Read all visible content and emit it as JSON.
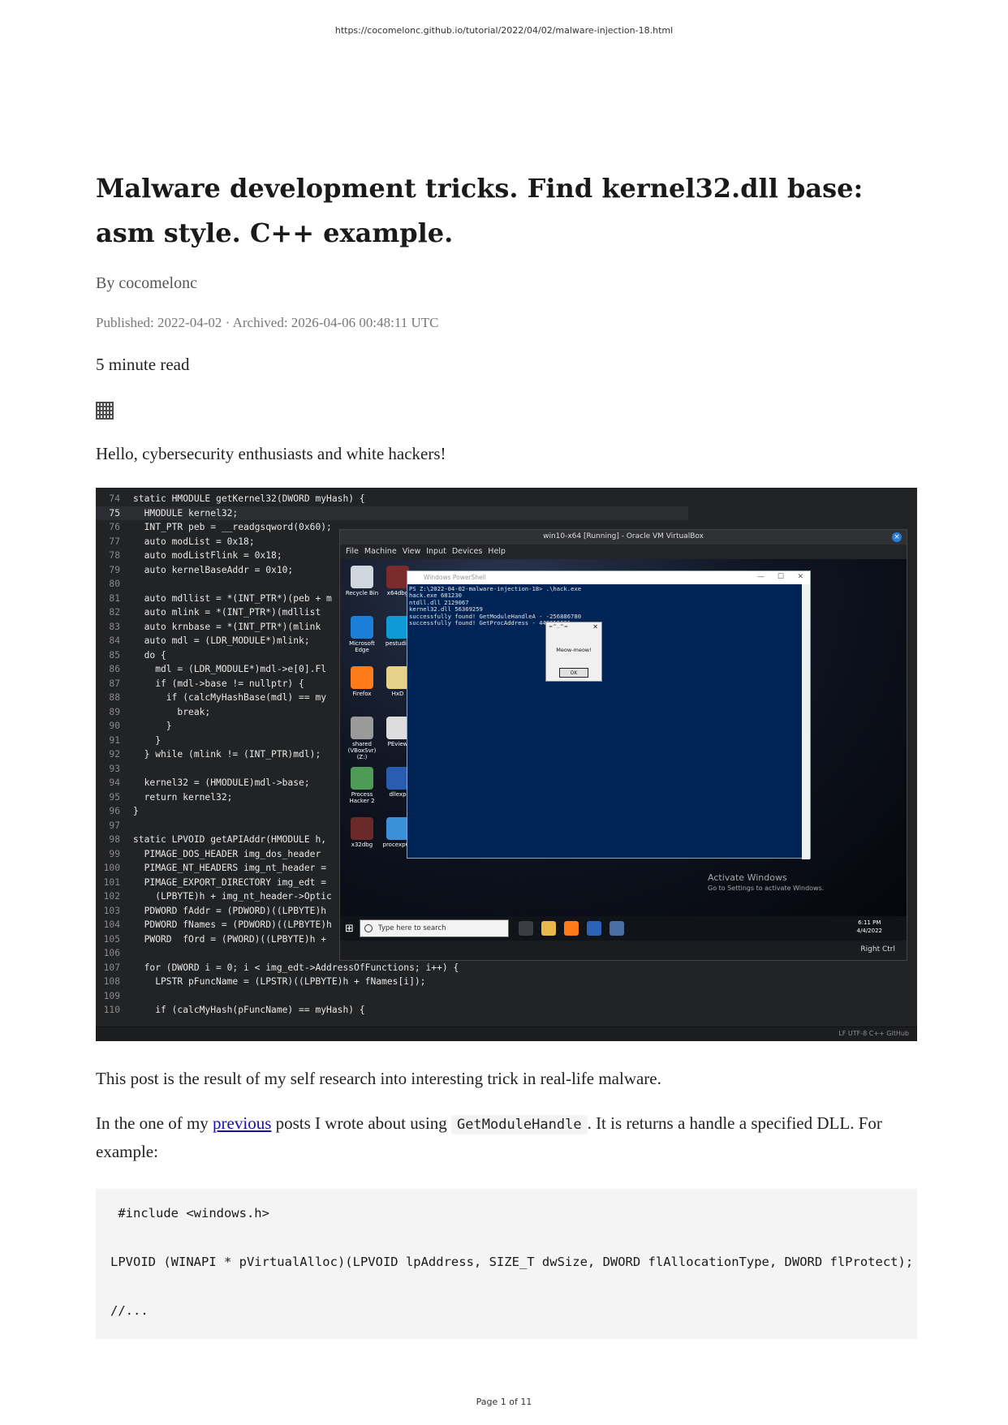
{
  "print_header": {
    "url": "https://cocomelonc.github.io/tutorial/2022/04/02/malware-injection-18.html"
  },
  "article": {
    "title": "Malware development tricks. Find kernel32.dll base: asm style. C++ example.",
    "byline": "By cocomelonc",
    "meta": "Published: 2022-04-02 · Archived: 2026-04-06 00:48:11 UTC",
    "read_time": "5 minute read",
    "greeting": "Hello, cybersecurity enthusiasts and white hackers!",
    "para1": "This post is the result of my self research into interesting trick in real-life malware.",
    "para2_before": "In the one of my ",
    "para2_link": "previous",
    "para2_middle": " posts I wrote about using ",
    "para2_code": "GetModuleHandle",
    "para2_after": ". It is returns a handle a specified DLL. For example:"
  },
  "screenshot": {
    "code_lines": [
      {
        "n": "74",
        "t": "static HMODULE getKernel32(DWORD myHash) {"
      },
      {
        "n": "75",
        "t": "  HMODULE kernel32;"
      },
      {
        "n": "76",
        "t": "  INT_PTR peb = __readgsqword(0x60);"
      },
      {
        "n": "77",
        "t": "  auto modList = 0x18;"
      },
      {
        "n": "78",
        "t": "  auto modListFlink = 0x18;"
      },
      {
        "n": "79",
        "t": "  auto kernelBaseAddr = 0x10;"
      },
      {
        "n": "80",
        "t": ""
      },
      {
        "n": "81",
        "t": "  auto mdllist = *(INT_PTR*)(peb + m"
      },
      {
        "n": "82",
        "t": "  auto mlink = *(INT_PTR*)(mdllist"
      },
      {
        "n": "83",
        "t": "  auto krnbase = *(INT_PTR*)(mlink"
      },
      {
        "n": "84",
        "t": "  auto mdl = (LDR_MODULE*)mlink;"
      },
      {
        "n": "85",
        "t": "  do {"
      },
      {
        "n": "86",
        "t": "    mdl = (LDR_MODULE*)mdl->e[0].Fl"
      },
      {
        "n": "87",
        "t": "    if (mdl->base != nullptr) {"
      },
      {
        "n": "88",
        "t": "      if (calcMyHashBase(mdl) == my"
      },
      {
        "n": "89",
        "t": "        break;"
      },
      {
        "n": "90",
        "t": "      }"
      },
      {
        "n": "91",
        "t": "    }"
      },
      {
        "n": "92",
        "t": "  } while (mlink != (INT_PTR)mdl);"
      },
      {
        "n": "93",
        "t": ""
      },
      {
        "n": "94",
        "t": "  kernel32 = (HMODULE)mdl->base;"
      },
      {
        "n": "95",
        "t": "  return kernel32;"
      },
      {
        "n": "96",
        "t": "}"
      },
      {
        "n": "97",
        "t": ""
      },
      {
        "n": "98",
        "t": "static LPVOID getAPIAddr(HMODULE h,"
      },
      {
        "n": "99",
        "t": "  PIMAGE_DOS_HEADER img_dos_header"
      },
      {
        "n": "100",
        "t": "  PIMAGE_NT_HEADERS img_nt_header ="
      },
      {
        "n": "101",
        "t": "  PIMAGE_EXPORT_DIRECTORY img_edt ="
      },
      {
        "n": "102",
        "t": "    (LPBYTE)h + img_nt_header->Optic"
      },
      {
        "n": "103",
        "t": "  PDWORD fAddr = (PDWORD)((LPBYTE)h"
      },
      {
        "n": "104",
        "t": "  PDWORD fNames = (PDWORD)((LPBYTE)h"
      },
      {
        "n": "105",
        "t": "  PWORD  fOrd = (PWORD)((LPBYTE)h +"
      },
      {
        "n": "106",
        "t": ""
      },
      {
        "n": "107",
        "t": "  for (DWORD i = 0; i < img_edt->AddressOfFunctions; i++) {"
      },
      {
        "n": "108",
        "t": "    LPSTR pFuncName = (LPSTR)((LPBYTE)h + fNames[i]);"
      },
      {
        "n": "109",
        "t": ""
      },
      {
        "n": "110",
        "t": "    if (calcMyHash(pFuncName) == myHash) {"
      }
    ],
    "editor_status": "LF   UTF-8   C++   GitHub",
    "vm_title": "win10-x64 [Running] - Oracle VM VirtualBox",
    "vm_close_glyph": "×",
    "vm_menu": [
      "File",
      "Machine",
      "View",
      "Input",
      "Devices",
      "Help"
    ],
    "desktop_icons": [
      {
        "label": "Recycle Bin",
        "color": "#cfd6de"
      },
      {
        "label": "x64dbg",
        "color": "#7a2b2b"
      },
      {
        "label": "Microsoft Edge",
        "color": "#1b7fd8"
      },
      {
        "label": "pestudio",
        "color": "#0f9ad6"
      },
      {
        "label": "Firefox",
        "color": "#ff7a18"
      },
      {
        "label": "HxD",
        "color": "#e6d08a"
      },
      {
        "label": "shared (VBoxSvr) (Z:)",
        "color": "#9a9a9a"
      },
      {
        "label": "PEview",
        "color": "#dddddd"
      },
      {
        "label": "Process Hacker 2",
        "color": "#4e9a57"
      },
      {
        "label": "dllexp",
        "color": "#2a5db0"
      },
      {
        "label": "x32dbg",
        "color": "#6b2a2a"
      },
      {
        "label": "procexp64",
        "color": "#3c8fd9"
      }
    ],
    "ps_title": "Windows PowerShell",
    "ps_lines": [
      "PS Z:\\2022-04-02-malware-injection-18> .\\hack.exe",
      "hack.exe 681230",
      "ntdll.dll 2129067",
      "kernel32.dll 56369259",
      "successfully found! GetModuleHandleA - -256886780",
      "successfully found! GetProcAddress - 448915681"
    ],
    "msgbox_title": "=^..^=",
    "msgbox_text": "Meow-meow!",
    "msgbox_ok": "OK",
    "activate_line1": "Activate Windows",
    "activate_line2": "Go to Settings to activate Windows.",
    "taskbar_search": "Type here to search",
    "taskbar_time": "6:11 PM",
    "taskbar_date": "4/4/2022",
    "host_tray": "Right Ctrl"
  },
  "code_block": {
    "lines": [
      " #include <windows.h>",
      "LPVOID (WINAPI * pVirtualAlloc)(LPVOID lpAddress, SIZE_T dwSize, DWORD flAllocationType, DWORD flProtect);",
      "//..."
    ]
  },
  "footer": {
    "page": "Page 1 of 11"
  }
}
